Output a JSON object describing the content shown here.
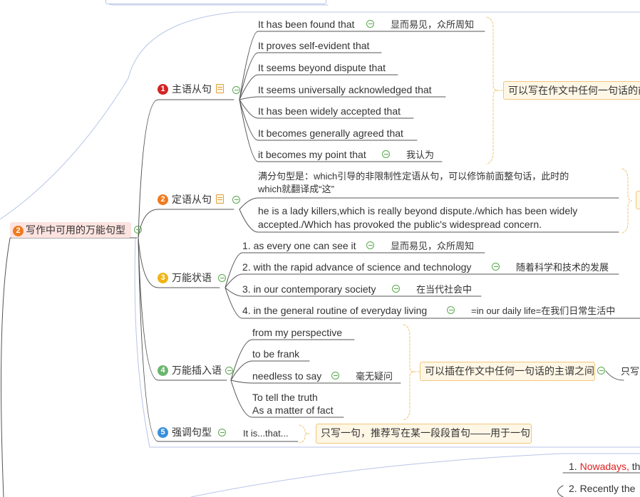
{
  "root": {
    "num": "2",
    "label": "写作中可用的万能句型"
  },
  "branches": [
    {
      "num": "1",
      "label": "主语从句",
      "color": "#d22525"
    },
    {
      "num": "2",
      "label": "定语从句",
      "color": "#f07a1e"
    },
    {
      "num": "3",
      "label": "万能状语",
      "color": "#f1b315"
    },
    {
      "num": "4",
      "label": "万能插入语",
      "color": "#6bb56f"
    },
    {
      "num": "5",
      "label": "强调句型",
      "color": "#3a8fd9"
    }
  ],
  "subject_clauses": [
    {
      "text": "It has been found that",
      "note": "显而易见，众所周知"
    },
    {
      "text": "It proves self-evident that"
    },
    {
      "text": "It seems beyond dispute that"
    },
    {
      "text": "It seems universally acknowledged that"
    },
    {
      "text": "It has been widely accepted that"
    },
    {
      "text": "It becomes generally agreed that"
    },
    {
      "text": "it becomes my point that",
      "note": "我认为"
    }
  ],
  "subject_summary": "可以写在作文中任何一句话的前",
  "attributive": {
    "line1a": "满分句型是：which引导的非限制性定语从句，可以修饰前面整句话，此时的",
    "line1b": "which就翻译成“这”",
    "line2a": "he is a lady killers,which is really beyond dispute./which has been widely",
    "line2b": "accepted./Which has provoked the public's widespread concern."
  },
  "adverbials": [
    {
      "text": "1. as every one can see it",
      "note": "显而易见，众所周知"
    },
    {
      "text": "2. with the rapid advance of science and technology",
      "note": "随着科学和技术的发展"
    },
    {
      "text": "3. in our contemporary society",
      "note": "在当代社会中"
    },
    {
      "text": "4. in the general routine of everyday living",
      "note": "=in our daily life=在我们日常生活中"
    }
  ],
  "insertions": [
    {
      "text": "from my perspective"
    },
    {
      "text": "to be frank"
    },
    {
      "text": "needless to say",
      "note": "毫无疑问"
    },
    {
      "text": "To tell the truth",
      "text2": "As a matter of fact"
    }
  ],
  "insertion_summary": "可以插在作文中任何一句话的主谓之间",
  "insertion_extra": "只写",
  "emphasis": {
    "text": "It is...that...",
    "note": "只写一句，推荐写在某一段段首句——用于一句"
  },
  "bottom": {
    "item1_prefix": "1. ",
    "item1_red": "Nowadays,",
    "item1_rest": " th",
    "item2": "2. Recently the"
  }
}
